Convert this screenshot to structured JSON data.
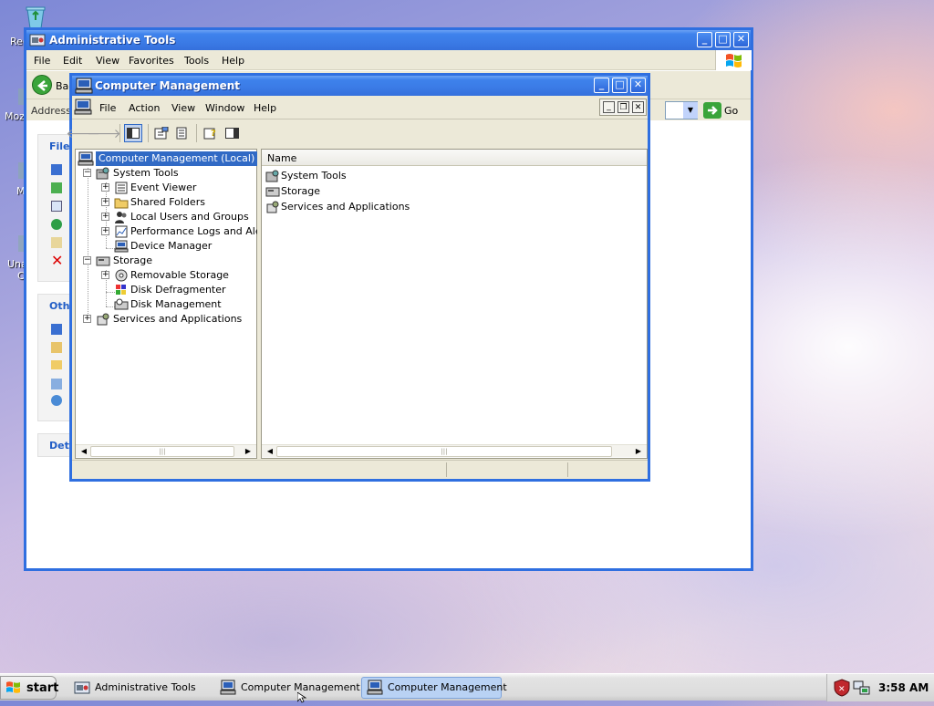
{
  "desktop": {
    "icon_labels": [
      "Rec",
      "Mozi",
      "M",
      "Una",
      "C"
    ]
  },
  "admin_window": {
    "title": "Administrative Tools",
    "menu": [
      "File",
      "Edit",
      "View",
      "Favorites",
      "Tools",
      "Help"
    ],
    "back_label": "Bac",
    "address_label": "Address",
    "go_label": "Go",
    "panels": [
      {
        "label": "File"
      },
      {
        "label": "Oth"
      },
      {
        "label": "Det"
      }
    ]
  },
  "cm_window": {
    "title": "Computer Management",
    "menu": [
      "File",
      "Action",
      "View",
      "Window",
      "Help"
    ],
    "tree": {
      "root": "Computer Management (Local)",
      "system_tools": "System Tools",
      "system_children": [
        "Event Viewer",
        "Shared Folders",
        "Local Users and Groups",
        "Performance Logs and Alerts",
        "Device Manager"
      ],
      "storage": "Storage",
      "storage_children": [
        "Removable Storage",
        "Disk Defragmenter",
        "Disk Management"
      ],
      "services": "Services and Applications"
    },
    "list": {
      "column_header": "Name",
      "items": [
        "System Tools",
        "Storage",
        "Services and Applications"
      ]
    }
  },
  "taskbar": {
    "start_label": "start",
    "tasks": [
      "Administrative Tools",
      "Computer Management",
      "Computer Management"
    ],
    "clock": "3:58 AM"
  }
}
